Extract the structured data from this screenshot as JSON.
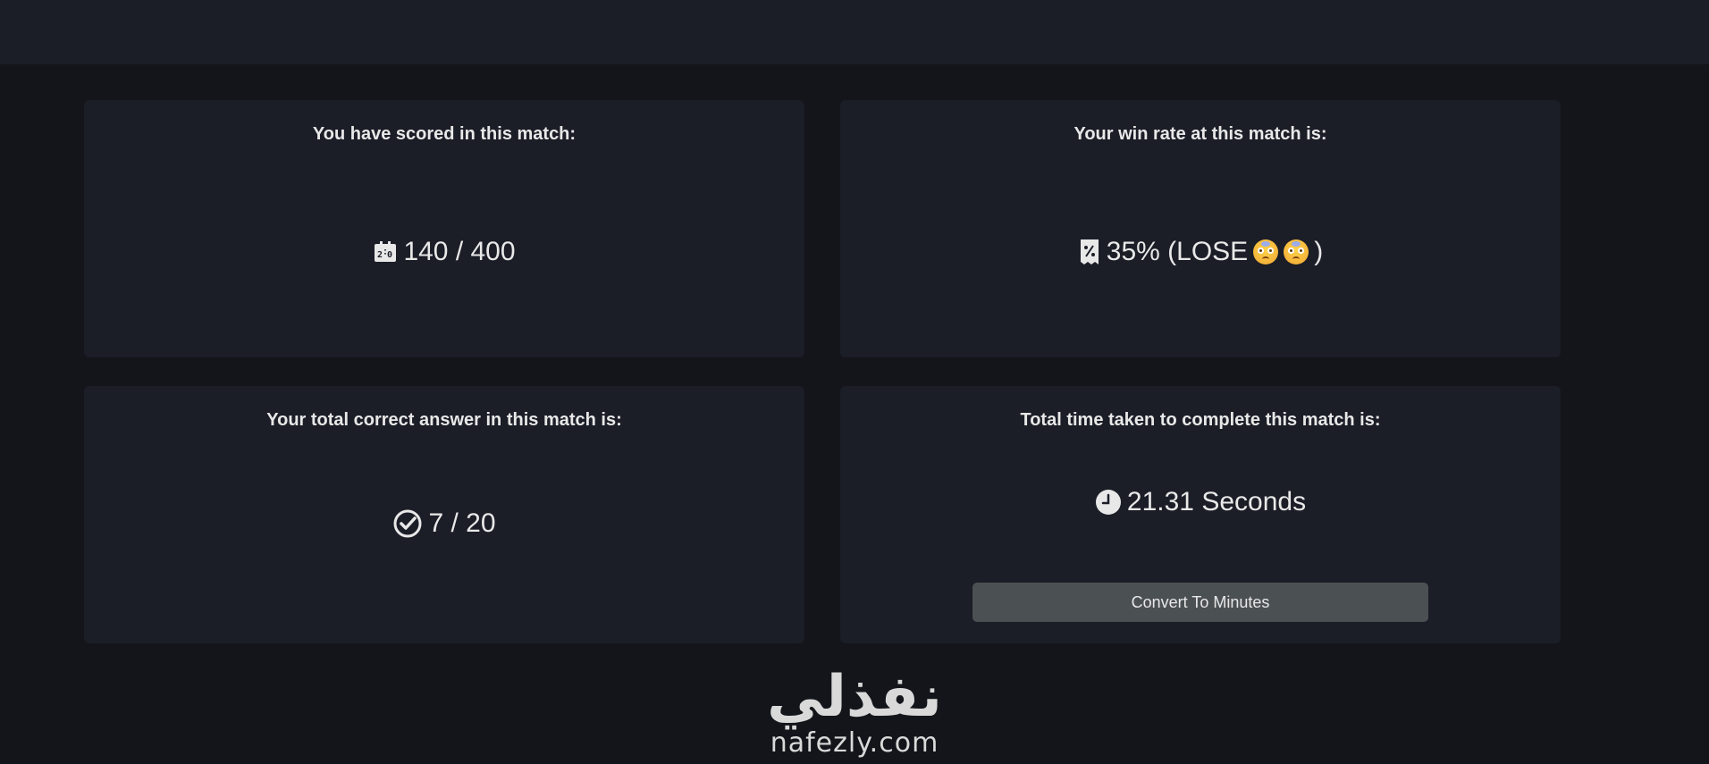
{
  "cards": {
    "score": {
      "title": "You have scored in this match:",
      "icon": "scoreboard-icon",
      "value": "140 / 400"
    },
    "win_rate": {
      "title": "Your win rate at this match is:",
      "icon": "receipt-percent-icon",
      "value_prefix": "35% (LOSE",
      "value_suffix": ")",
      "emoji": "flushed-face-emoji"
    },
    "correct": {
      "title": "Your total correct answer in this match is:",
      "icon": "check-circle-icon",
      "value": "7 / 20"
    },
    "time": {
      "title": "Total time taken to complete this match is:",
      "icon": "clock-icon",
      "value": "21.31 Seconds",
      "button_label": "Convert To Minutes"
    }
  },
  "footer": {
    "logo_arabic": "نفذلي",
    "logo_domain": "nafezly.com"
  },
  "colors": {
    "background": "#13151a",
    "card": "#1b1d27",
    "button": "#4b5052",
    "text": "#e8e8e8"
  }
}
